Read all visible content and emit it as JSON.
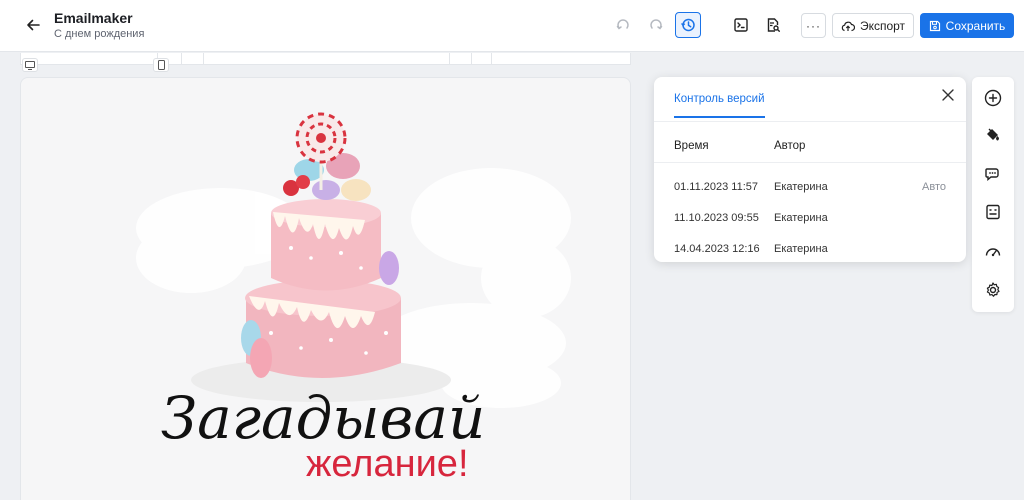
{
  "header": {
    "title": "Emailmaker",
    "subtitle": "С днем рождения",
    "more_label": "···",
    "export_label": "Экспорт",
    "save_label": "Сохранить"
  },
  "hero": {
    "headline": "Загадывай",
    "subline": "желание!"
  },
  "versions": {
    "tab_label": "Контроль версий",
    "columns": {
      "time": "Время",
      "author": "Автор"
    },
    "rows": [
      {
        "time": "01.11.2023 11:57",
        "author": "Екатерина",
        "tag": "Авто"
      },
      {
        "time": "11.10.2023 09:55",
        "author": "Екатерина",
        "tag": ""
      },
      {
        "time": "14.04.2023 12:16",
        "author": "Екатерина",
        "tag": ""
      }
    ]
  },
  "icons": {
    "back": "arrow-left-icon",
    "undo": "undo-icon",
    "redo": "redo-icon",
    "history": "history-icon",
    "code": "code-icon",
    "preview": "preview-icon",
    "export": "cloud-upload-icon",
    "save": "save-icon",
    "close": "close-icon",
    "desktop": "desktop-icon",
    "mobile": "mobile-icon",
    "rail": [
      "add-icon",
      "paint-bucket-icon",
      "comments-icon",
      "template-icon",
      "speedometer-icon",
      "settings-icon"
    ]
  },
  "colors": {
    "accent": "#1a73e8",
    "headline": "#111111",
    "subline": "#d7263d"
  }
}
